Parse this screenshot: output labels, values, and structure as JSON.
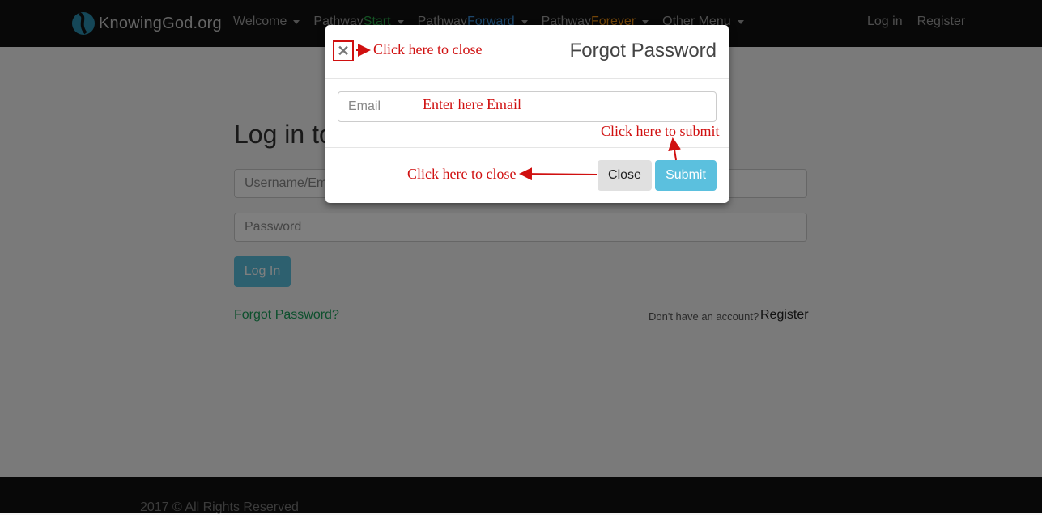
{
  "navbar": {
    "brand": "KnowingGod.org",
    "menu": [
      {
        "prefix": "Welcome",
        "accent": ""
      },
      {
        "prefix": "Pathway",
        "accent": "Start"
      },
      {
        "prefix": "Pathway",
        "accent": "Forward"
      },
      {
        "prefix": "Pathway",
        "accent": "Forever"
      },
      {
        "prefix": "Other Menu",
        "accent": ""
      }
    ],
    "login": "Log in",
    "register": "Register"
  },
  "login_page": {
    "title": "Log in to",
    "username_placeholder": "Username/Email",
    "password_placeholder": "Password",
    "login_button": "Log In",
    "forgot_link": "Forgot Password?",
    "no_account_text": "Don't have an account?",
    "register_link": "Register"
  },
  "modal": {
    "title": "Forgot Password",
    "close_symbol": "✕",
    "email_placeholder": "Email",
    "close_button": "Close",
    "submit_button": "Submit"
  },
  "annotations": {
    "close_top": "Click here to close",
    "enter_email": "Enter here Email",
    "submit": "Click here to submit",
    "close_bottom": "Click here to close"
  },
  "footer": {
    "text": "2017 © All Rights Reserved"
  },
  "colors": {
    "accent_start": "#2aa84a",
    "accent_forward": "#3a8fd9",
    "accent_forever": "#e58a12",
    "annotation_red": "#d01010",
    "button_info": "#5bc0de"
  }
}
